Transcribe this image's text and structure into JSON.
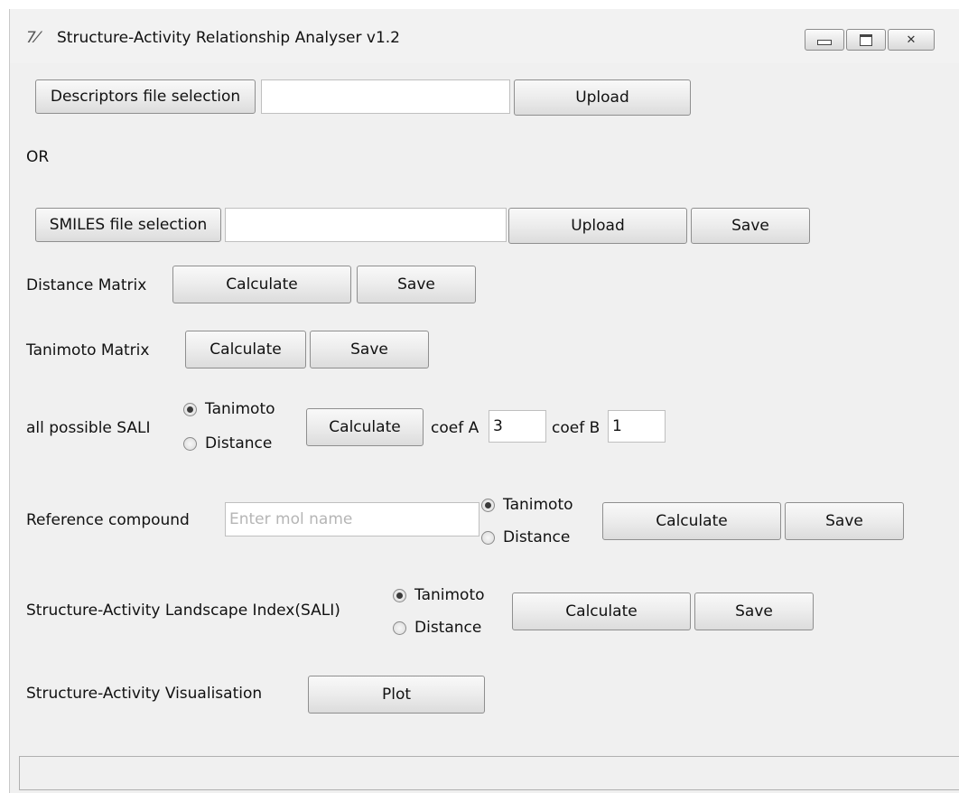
{
  "window": {
    "icon": "tk-feather-icon",
    "title": "Structure-Activity Relationship Analyser v1.2",
    "controls": [
      "minimize-icon",
      "maximize-icon",
      "close-icon"
    ]
  },
  "descriptors": {
    "select_label": "Descriptors file selection",
    "path_value": "",
    "upload_label": "Upload"
  },
  "or_label": "OR",
  "smiles": {
    "select_label": "SMILES file selection",
    "path_value": "",
    "upload_label": "Upload",
    "save_label": "Save"
  },
  "distance_matrix": {
    "label": "Distance Matrix",
    "calculate_label": "Calculate",
    "save_label": "Save"
  },
  "tanimoto_matrix": {
    "label": "Tanimoto Matrix",
    "calculate_label": "Calculate",
    "save_label": "Save"
  },
  "all_sali": {
    "label": "all possible SALI",
    "radio_tanimoto": "Tanimoto",
    "radio_distance": "Distance",
    "selected": "Tanimoto",
    "calculate_label": "Calculate",
    "coef_a_label": "coef A",
    "coef_a_value": "3",
    "coef_b_label": "coef B",
    "coef_b_value": "1"
  },
  "reference": {
    "label": "Reference compound",
    "placeholder": "Enter mol name",
    "radio_tanimoto": "Tanimoto",
    "radio_distance": "Distance",
    "selected": "Tanimoto",
    "calculate_label": "Calculate",
    "save_label": "Save"
  },
  "sali": {
    "label": "Structure-Activity Landscape Index(SALI)",
    "radio_tanimoto": "Tanimoto",
    "radio_distance": "Distance",
    "selected": "Tanimoto",
    "calculate_label": "Calculate",
    "save_label": "Save"
  },
  "visualisation": {
    "label": "Structure-Activity Visualisation",
    "plot_label": "Plot"
  },
  "status": ""
}
